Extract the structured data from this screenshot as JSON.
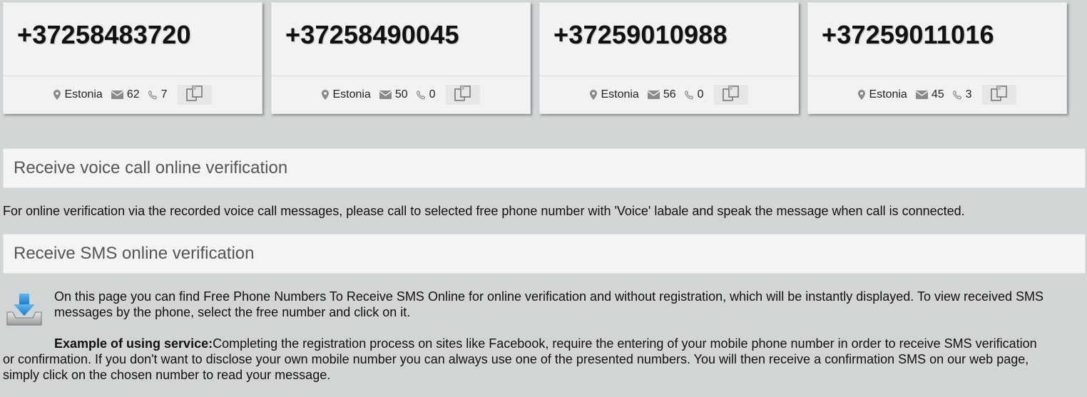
{
  "cards": [
    {
      "number": "+37258483720",
      "country": "Estonia",
      "sms": "62",
      "calls": "7"
    },
    {
      "number": "+37258490045",
      "country": "Estonia",
      "sms": "50",
      "calls": "0"
    },
    {
      "number": "+37259010988",
      "country": "Estonia",
      "sms": "56",
      "calls": "0"
    },
    {
      "number": "+37259011016",
      "country": "Estonia",
      "sms": "45",
      "calls": "3"
    }
  ],
  "voice_section": {
    "title": "Receive voice call online verification",
    "text": "For online verification via the recorded voice call messages, please call to selected free phone number with 'Voice' labale and speak the message when call is connected."
  },
  "sms_section": {
    "title": "Receive SMS online verification",
    "text_line1": "On this page you can find Free Phone Numbers To Receive SMS Online for online verification and without registration, which will be instantly displayed. To view received SMS",
    "text_line2": "messages by the phone, select the free number and click on it.",
    "example_label": "Example of using service:",
    "example_line1": "Completing the registration process on sites like Facebook, require the entering of your mobile phone number in order to receive SMS verification",
    "example_line2": "or confirmation. If you don't want to disclose your own mobile number you can always use one of the presented numbers. You will then receive a confirmation SMS on our web page,",
    "example_line3": "simply click on the chosen number to read your message."
  },
  "icons": {
    "location": "map-marker-icon",
    "sms": "envelope-icon",
    "calls": "phone-icon",
    "copy": "copy-icon",
    "download": "download-tray-icon"
  },
  "colors": {
    "background": "#d1d5d6",
    "card": "#f2f2f2",
    "icon_gray": "#8a8a8a",
    "download_blue": "#2a8fd6"
  }
}
